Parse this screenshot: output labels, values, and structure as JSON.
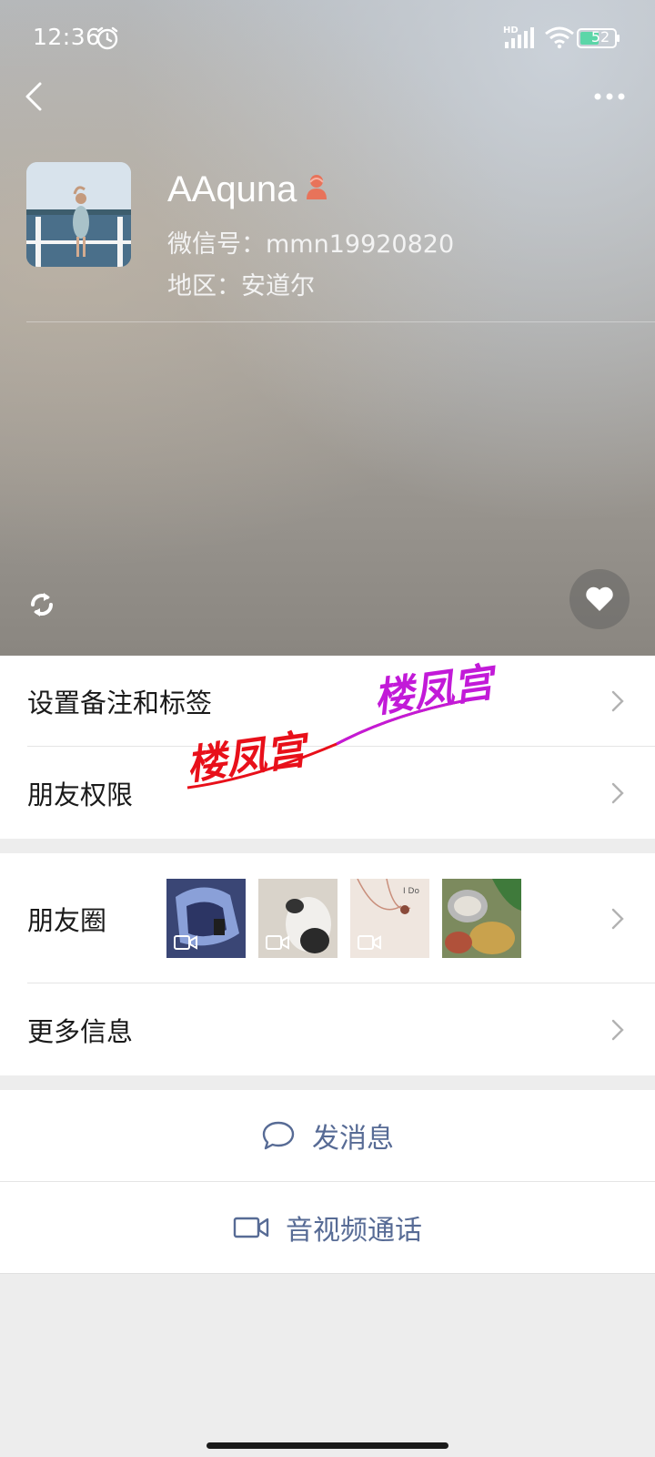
{
  "status_bar": {
    "time": "12:36",
    "network_tag": "HD",
    "battery_level": "52",
    "icons": [
      "alarm-icon",
      "signal-icon",
      "wifi-icon",
      "battery-icon"
    ]
  },
  "header": {
    "back_icon": "back-icon",
    "more_icon": "more-icon"
  },
  "profile": {
    "nickname": "AAquna",
    "gender_icon": "female-icon",
    "gender_color": "#e8735a",
    "wechat_id": "微信号：mmn19920820",
    "region": "地区：安道尔"
  },
  "hero_actions": {
    "refresh_icon": "refresh-icon",
    "like_icon": "heart-icon"
  },
  "menu_top": [
    {
      "label": "设置备注和标签",
      "icon": "chevron-right-icon"
    },
    {
      "label": "朋友权限",
      "icon": "chevron-right-icon"
    }
  ],
  "menu_bottom": [
    {
      "label": "朋友圈",
      "thumbnails": 4,
      "icon": "chevron-right-icon"
    },
    {
      "label": "更多信息",
      "icon": "chevron-right-icon"
    }
  ],
  "actions": [
    {
      "label": "发消息",
      "icon": "chat-bubble-icon"
    },
    {
      "label": "音视频通话",
      "icon": "video-camera-icon"
    }
  ],
  "watermark": {
    "text_1": "楼凤宫",
    "text_2": "楼凤宫",
    "colors": [
      "#e8101a",
      "#c21ad8"
    ]
  },
  "colors": {
    "link_blue": "#576b95",
    "background": "#ededed"
  }
}
